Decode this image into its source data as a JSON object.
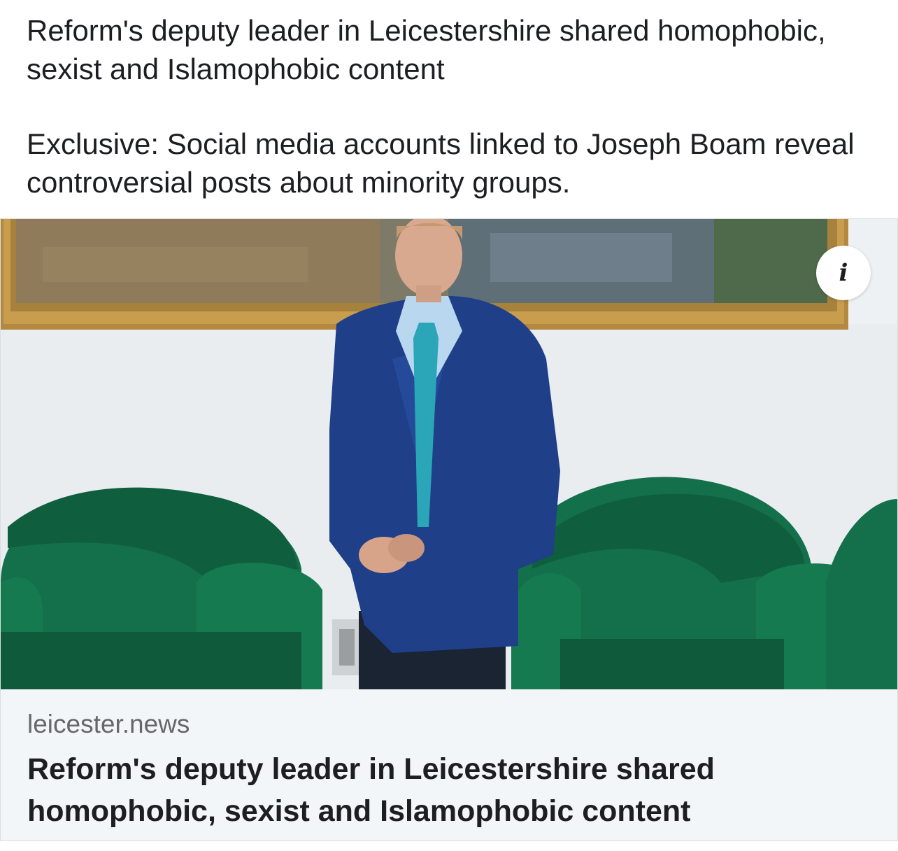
{
  "post": {
    "message_line1": "Reform's deputy leader in Leicestershire shared homophobic, sexist and Islamophobic content",
    "message_line2": "Exclusive: Social media accounts linked to Joseph Boam reveal controversial posts about minority groups."
  },
  "link_card": {
    "image_icon": "info-icon",
    "info_glyph": "i",
    "domain": "leicester.news",
    "title": "Reform's deputy leader in Leicestershire shared homophobic, sexist and Islamophobic content"
  },
  "colors": {
    "text": "#1c1e21",
    "muted": "#65676b",
    "card_background": "#f3f6f8",
    "armchair_green": "#14704a",
    "suit_blue": "#1f3f88",
    "tie_teal": "#2aa6b8"
  }
}
